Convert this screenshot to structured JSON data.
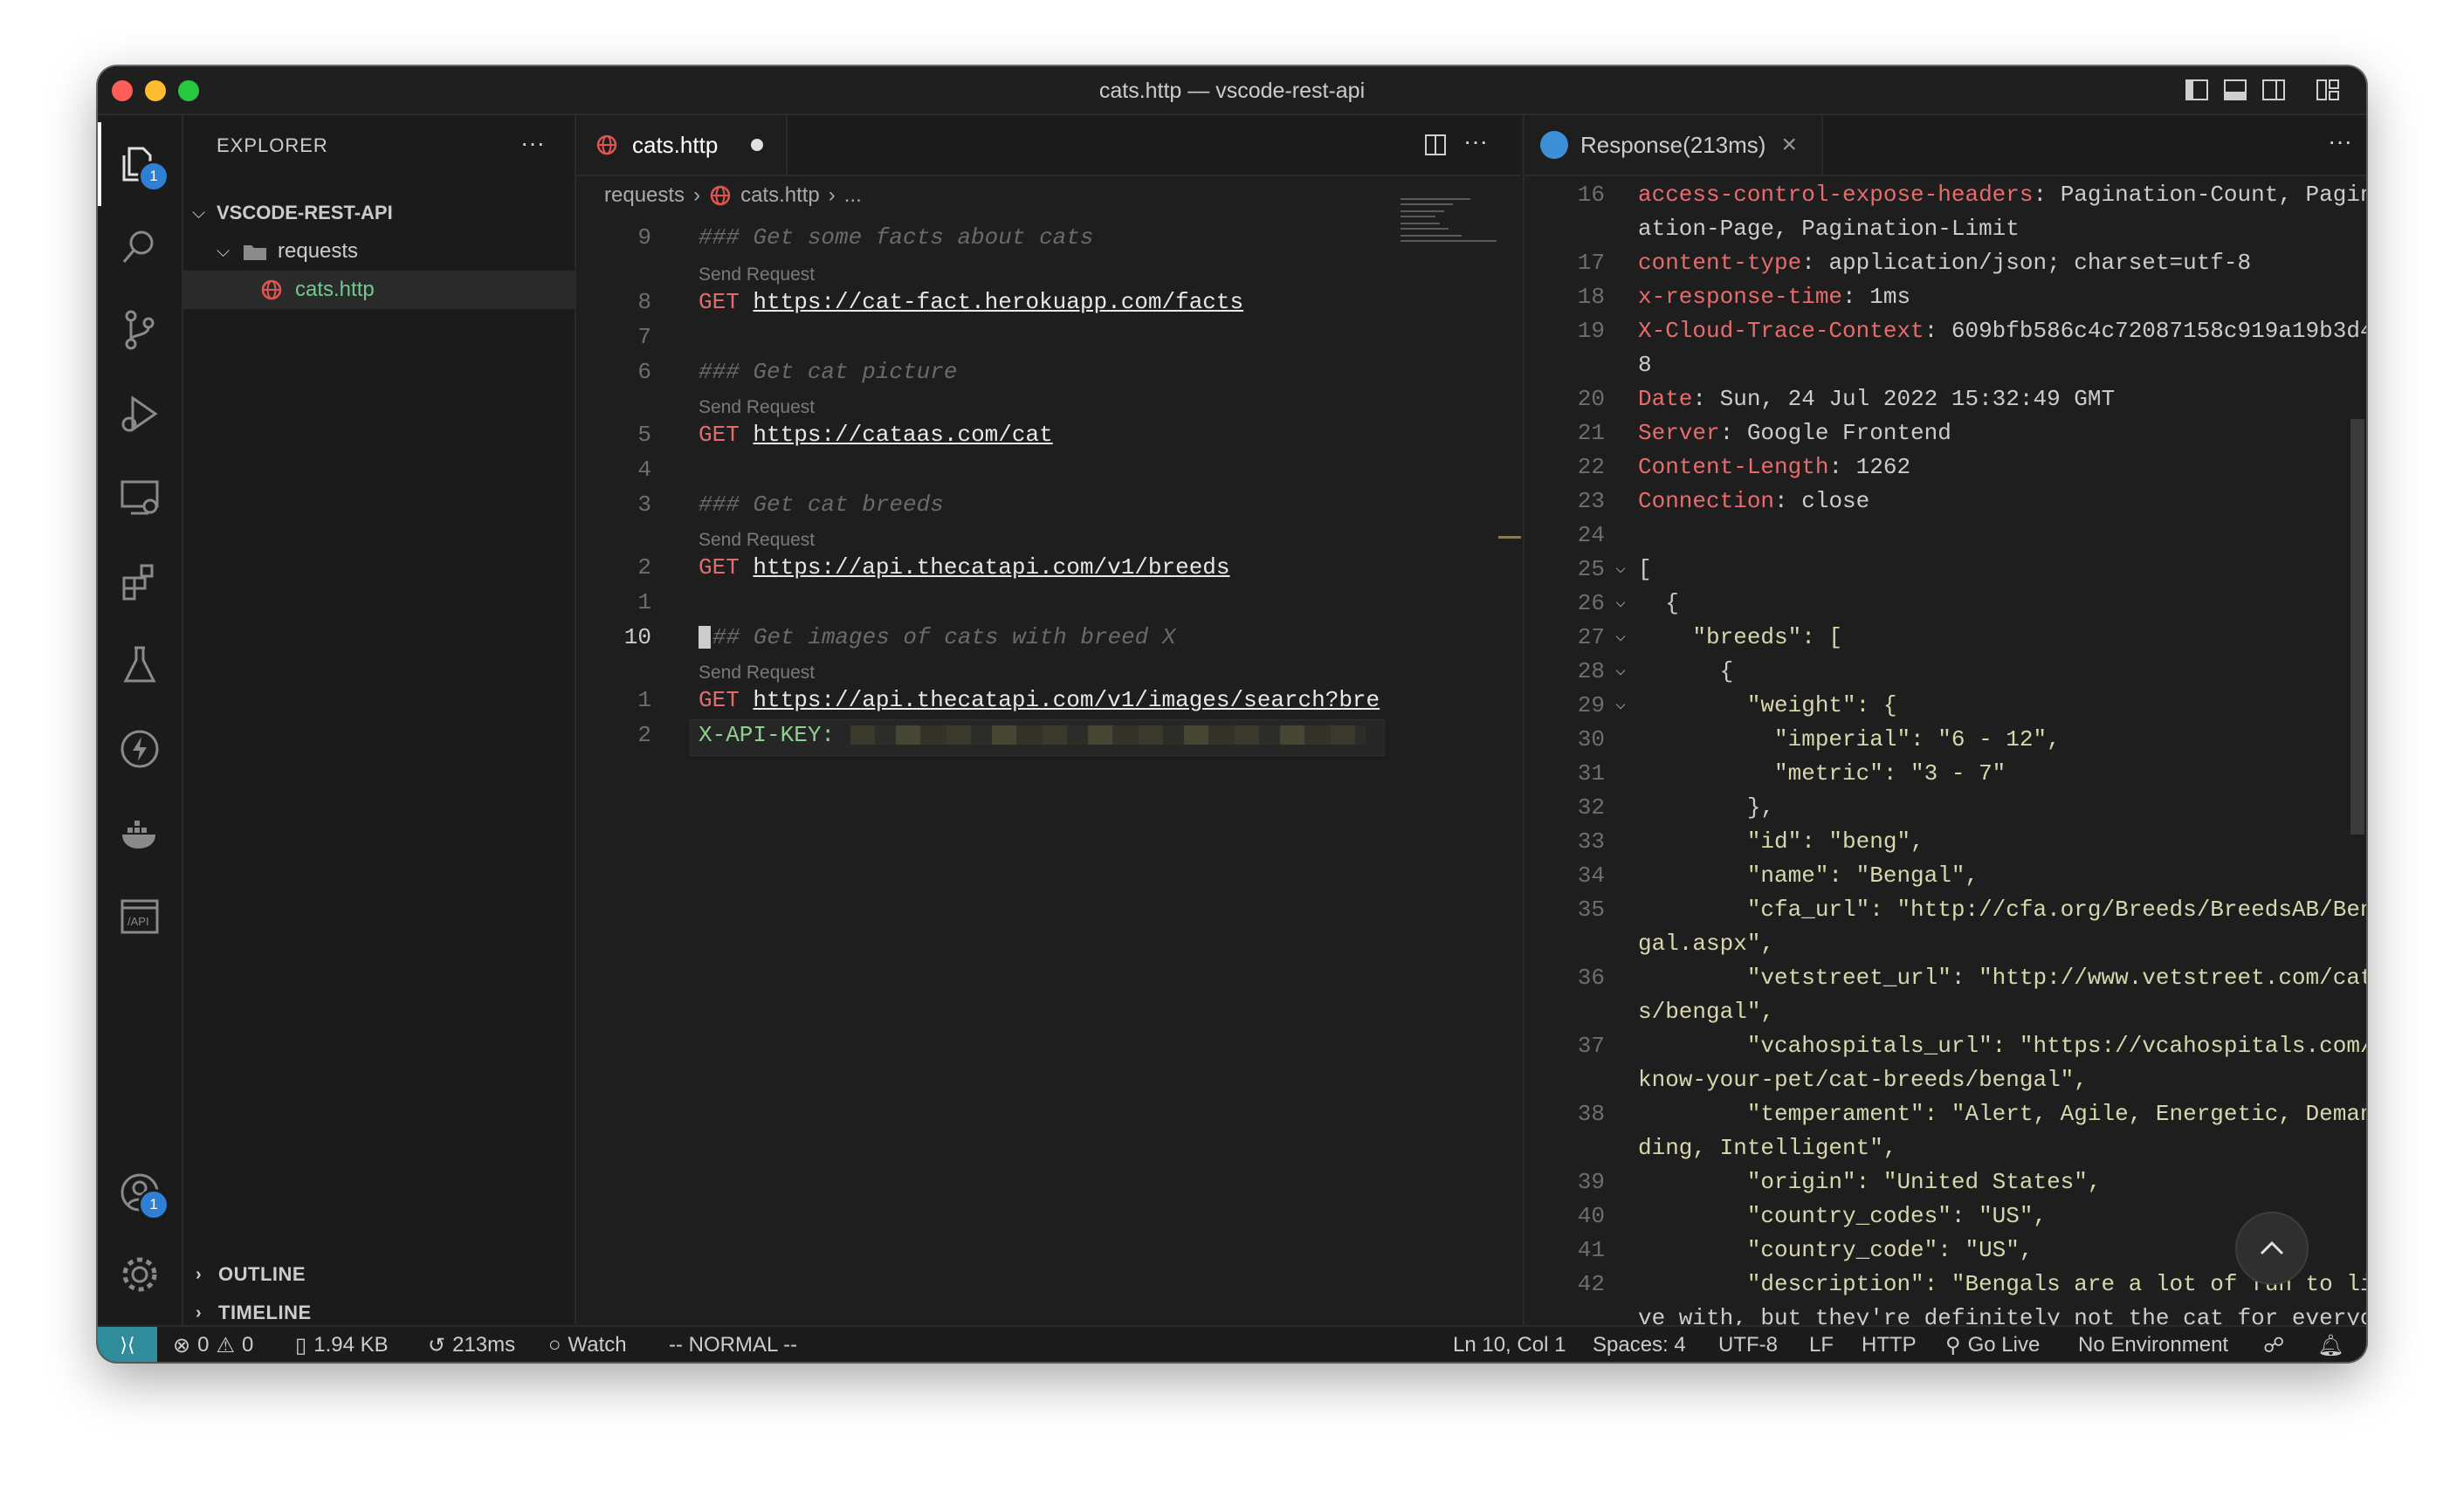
{
  "window": {
    "title": "cats.http — vscode-rest-api"
  },
  "activity_bar": {
    "explorer_badge": "1",
    "accounts_badge": "1"
  },
  "sidebar": {
    "header": "EXPLORER",
    "more": "···",
    "root": "VSCODE-REST-API",
    "folder": "requests",
    "file": "cats.http",
    "outline": "OUTLINE",
    "timeline": "TIMELINE"
  },
  "editor": {
    "tab_label": "cats.http",
    "breadcrumb": {
      "folder": "requests",
      "file": "cats.http",
      "more": "..."
    },
    "codelens_label": "Send Request",
    "lines": {
      "c9": "### Get some facts about cats",
      "u8": "https://cat-fact.herokuapp.com/facts",
      "c6": "### Get cat picture",
      "u5": "https://cataas.com/cat",
      "c3": "### Get cat breeds",
      "u2": "https://api.thecatapi.com/v1/breeds",
      "c10": "## Get images of cats with breed X",
      "u1": "https://api.thecatapi.com/v1/images/search?bre",
      "apikey": "X-API-KEY:"
    },
    "method": "GET",
    "line_numbers": [
      "9",
      "8",
      "7",
      "6",
      "5",
      "4",
      "3",
      "2",
      "1",
      "10",
      "1",
      "2"
    ]
  },
  "response": {
    "tab_label": "Response(213ms)",
    "close": "×",
    "more": "···",
    "lines": [
      {
        "n": "16",
        "k": "access-control-expose-headers",
        "v": ": Pagination-Count, Pagin"
      },
      {
        "n": "",
        "k": "",
        "v": "ation-Page, Pagination-Limit"
      },
      {
        "n": "17",
        "k": "content-type",
        "v": ": application/json; charset=utf-8"
      },
      {
        "n": "18",
        "k": "x-response-time",
        "v": ": 1ms"
      },
      {
        "n": "19",
        "k": "X-Cloud-Trace-Context",
        "v": ": 609bfb586c4c72087158c919a19b3d4"
      },
      {
        "n": "",
        "k": "",
        "v": "8"
      },
      {
        "n": "20",
        "k": "Date",
        "v": ": Sun, 24 Jul 2022 15:32:49 GMT"
      },
      {
        "n": "21",
        "k": "Server",
        "v": ": Google Frontend"
      },
      {
        "n": "22",
        "k": "Content-Length",
        "v": ": 1262"
      },
      {
        "n": "23",
        "k": "Connection",
        "v": ": close"
      },
      {
        "n": "24",
        "k": "",
        "v": ""
      },
      {
        "n": "25",
        "c": "v",
        "k": "",
        "v": "["
      },
      {
        "n": "26",
        "c": "v",
        "k": "",
        "v": "  {"
      },
      {
        "n": "27",
        "c": "v",
        "k": "",
        "v": "    \"breeds\": ["
      },
      {
        "n": "28",
        "c": "v",
        "k": "",
        "v": "      {"
      },
      {
        "n": "29",
        "c": "v",
        "k": "",
        "v": "        \"weight\": {"
      },
      {
        "n": "30",
        "k": "",
        "v": "          \"imperial\": \"6 - 12\","
      },
      {
        "n": "31",
        "k": "",
        "v": "          \"metric\": \"3 - 7\""
      },
      {
        "n": "32",
        "k": "",
        "v": "        },"
      },
      {
        "n": "33",
        "k": "",
        "v": "        \"id\": \"beng\","
      },
      {
        "n": "34",
        "k": "",
        "v": "        \"name\": \"Bengal\","
      },
      {
        "n": "35",
        "k": "",
        "v": "        \"cfa_url\": \"http://cfa.org/Breeds/BreedsAB/Ben"
      },
      {
        "n": "",
        "k": "",
        "v": "gal.aspx\","
      },
      {
        "n": "36",
        "k": "",
        "v": "        \"vetstreet_url\": \"http://www.vetstreet.com/cat"
      },
      {
        "n": "",
        "k": "",
        "v": "s/bengal\","
      },
      {
        "n": "37",
        "k": "",
        "v": "        \"vcahospitals_url\": \"https://vcahospitals.com/"
      },
      {
        "n": "",
        "k": "",
        "v": "know-your-pet/cat-breeds/bengal\","
      },
      {
        "n": "38",
        "k": "",
        "v": "        \"temperament\": \"Alert, Agile, Energetic, Deman"
      },
      {
        "n": "",
        "k": "",
        "v": "ding, Intelligent\","
      },
      {
        "n": "39",
        "k": "",
        "v": "        \"origin\": \"United States\","
      },
      {
        "n": "40",
        "k": "",
        "v": "        \"country_codes\": \"US\","
      },
      {
        "n": "41",
        "k": "",
        "v": "        \"country_code\": \"US\","
      },
      {
        "n": "42",
        "k": "",
        "v": "        \"description\": \"Bengals are a lot of fun to li"
      },
      {
        "n": "",
        "k": "",
        "v": "ve with, but they're definitely not the cat for everyo"
      }
    ]
  },
  "statusbar": {
    "errors": "0",
    "warnings": "0",
    "size": "1.94 KB",
    "time": "213ms",
    "watch": "Watch",
    "mode": "-- NORMAL --",
    "position": "Ln 10, Col 1",
    "spaces": "Spaces: 4",
    "encoding": "UTF-8",
    "eol": "LF",
    "language": "HTTP",
    "golive": "Go Live",
    "environment": "No Environment"
  }
}
